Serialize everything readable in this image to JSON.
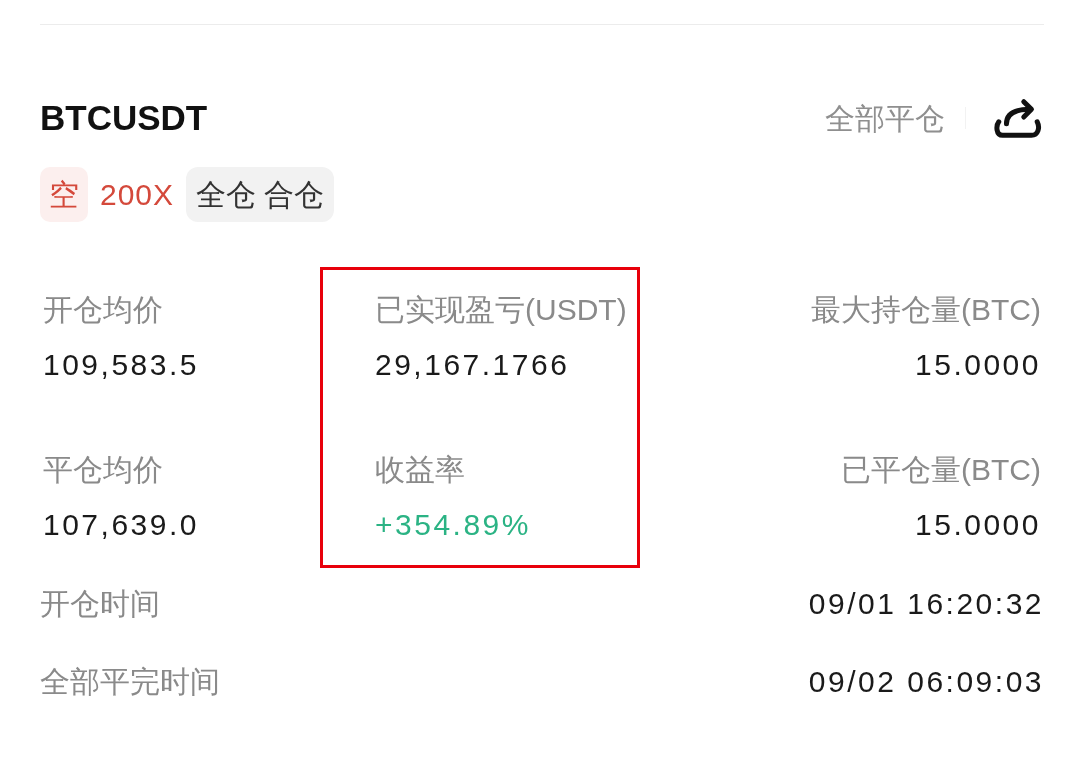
{
  "header": {
    "symbol": "BTCUSDT",
    "action": {
      "label": "全部平仓"
    }
  },
  "tags": [
    {
      "kind": "side",
      "label": "空"
    },
    {
      "kind": "leverage",
      "label": "200X"
    },
    {
      "kind": "mode",
      "label": "全仓 合仓"
    }
  ],
  "stats": [
    {
      "highlighted": false,
      "items": [
        {
          "label": "开仓均价",
          "value": "109,583.5",
          "color": "#1a1a1a"
        },
        {
          "label": "平仓均价",
          "value": "107,639.0",
          "color": "#1a1a1a"
        }
      ]
    },
    {
      "highlighted": true,
      "items": [
        {
          "label": "已实现盈亏(USDT)",
          "value": "29,167.1766",
          "color": "#1a1a1a"
        },
        {
          "label": "收益率",
          "value": "+354.89%",
          "color": "#2bb384"
        }
      ]
    },
    {
      "highlighted": false,
      "items": [
        {
          "label": "最大持仓量(BTC)",
          "value": "15.0000",
          "color": "#1a1a1a"
        },
        {
          "label": "已平仓量(BTC)",
          "value": "15.0000",
          "color": "#1a1a1a"
        }
      ]
    }
  ],
  "times": [
    {
      "label": "开仓时间",
      "value": "09/01 16:20:32"
    },
    {
      "label": "全部平完时间",
      "value": "09/02 06:09:03"
    }
  ]
}
